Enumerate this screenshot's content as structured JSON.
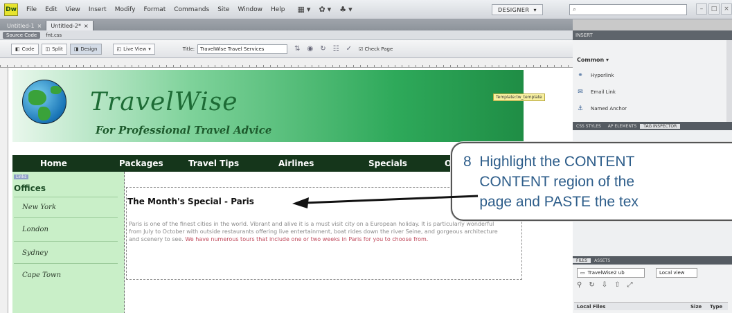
{
  "menubar": {
    "logo": "Dw",
    "items": [
      "File",
      "Edit",
      "View",
      "Insert",
      "Modify",
      "Format",
      "Commands",
      "Site",
      "Window",
      "Help"
    ],
    "workspace": "DESIGNER",
    "search_placeholder": ""
  },
  "doc_tabs": [
    {
      "label": "Untitled-1"
    },
    {
      "label": "Untitled-2*"
    }
  ],
  "related": {
    "source_code": "Source Code",
    "file": "fnt.css"
  },
  "doc_toolbar": {
    "code": "Code",
    "split": "Split",
    "design": "Design",
    "live_view": "Live View",
    "title_label": "Title:",
    "title_value": "TravelWise Travel Services",
    "check_page": "Check Page"
  },
  "page": {
    "brand_name": "TravelWise",
    "tagline": "For Professional Travel Advice",
    "template_tag": "Template:tw_template",
    "nav": [
      "Home",
      "Packages",
      "Travel Tips",
      "Airlines",
      "Specials",
      "O"
    ],
    "sidebar_region_tag": "Links",
    "sidebar_heading": "Offices",
    "offices": [
      "New York",
      "London",
      "Sydney",
      "Cape Town"
    ],
    "content_heading": "The Month's Special - Paris",
    "content_body_plain": "Paris is one of the finest cities in the world. Vibrant and alive it is a must visit city on a European holiday. It is particularly wonderful from July to October with outside restaurants offering live entertainment, boat rides down the river Seine, and gorgeous architecture and scenery to see.",
    "content_body_highlight": "We have numerous tours that include one or two weeks in Paris for you to choose from."
  },
  "right_panels": {
    "insert_title": "INSERT",
    "insert_category": "Common",
    "insert_items": [
      {
        "icon": "hyperlink-icon",
        "label": "Hyperlink"
      },
      {
        "icon": "email-link-icon",
        "label": "Email Link"
      },
      {
        "icon": "named-anchor-icon",
        "label": "Named Anchor"
      }
    ],
    "inspector_tabs": [
      "CSS STYLES",
      "AP ELEMENTS",
      "TAG INSPECTOR"
    ],
    "files_tabs": [
      "FILES",
      "ASSETS"
    ],
    "site": "TravelWise2 ub",
    "view": "Local view",
    "col_name": "Local Files",
    "col_size": "Size",
    "col_type": "Type"
  },
  "callout": {
    "text": "8  Highlight the CONTENT\n    CONTENT region of the\n    page and PASTE the tex"
  },
  "colors": {
    "nav_bg": "#15361b",
    "sidebar_bg": "#c9efc8",
    "callout_text": "#2d5d8a"
  }
}
